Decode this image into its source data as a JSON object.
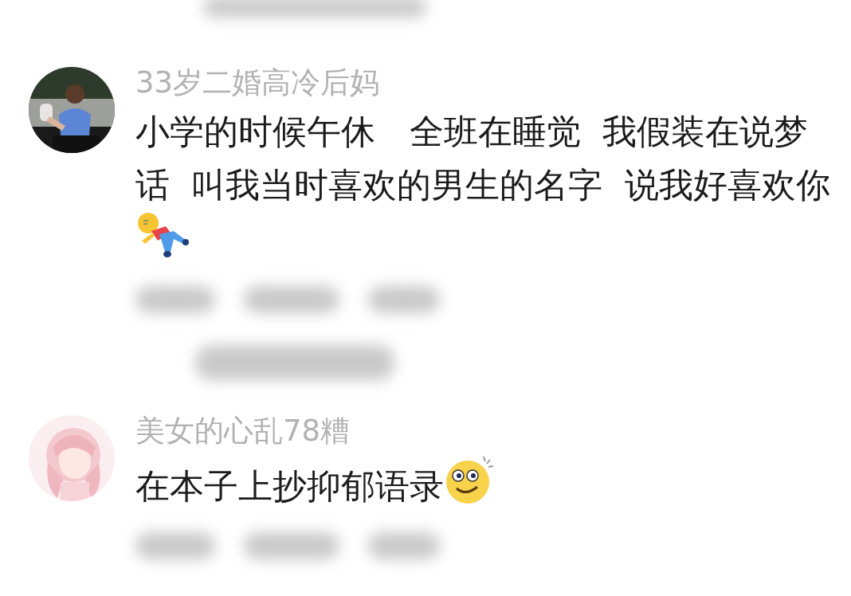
{
  "comments": [
    {
      "username": "33岁二婚高冷后妈",
      "text": "小学的时候午休　全班在睡觉  我假装在说梦话  叫我当时喜欢的男生的名字  说我好喜欢你",
      "emoji": {
        "kind": "lying"
      }
    },
    {
      "username": "美女的心乱78糟",
      "text": "在本子上抄抑郁语录",
      "emoji": {
        "kind": "smile"
      }
    }
  ]
}
